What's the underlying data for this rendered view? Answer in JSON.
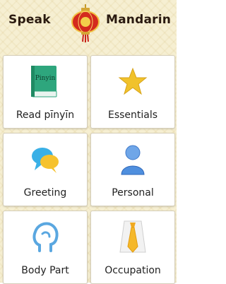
{
  "header": {
    "left_title": "Speak",
    "right_title": "Mandarin",
    "logo_icon": "lantern-icon"
  },
  "menu": [
    {
      "label": "Read pīnyīn",
      "icon": "book-icon",
      "icon_text": "Pinyin"
    },
    {
      "label": "Essentials",
      "icon": "star-icon"
    },
    {
      "label": "Greeting",
      "icon": "chat-bubbles-icon"
    },
    {
      "label": "Personal",
      "icon": "person-icon"
    },
    {
      "label": "Body Part",
      "icon": "head-icon"
    },
    {
      "label": "Occupation",
      "icon": "tie-icon"
    }
  ]
}
